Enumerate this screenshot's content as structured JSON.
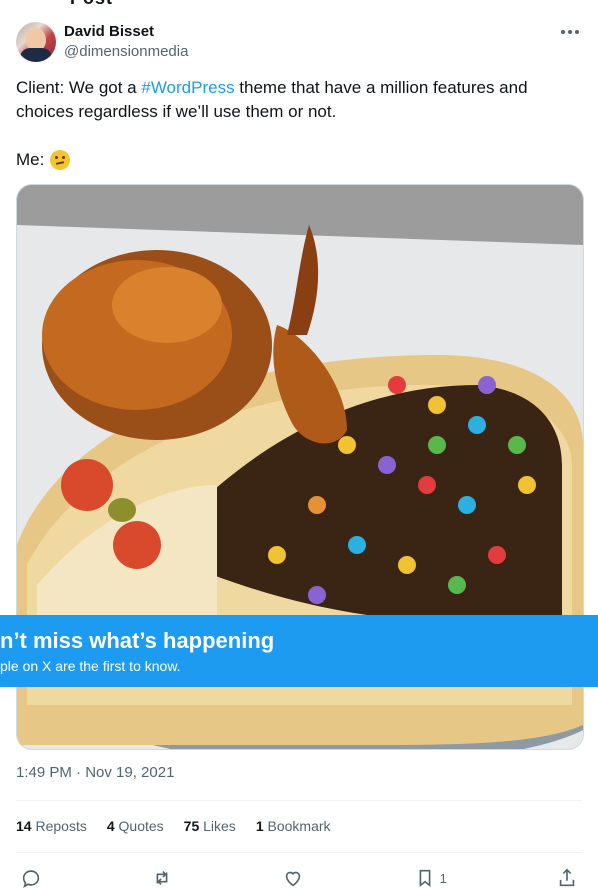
{
  "header": {
    "title_fragment": "Post"
  },
  "author": {
    "display_name": "David Bisset",
    "handle": "@dimensionmedia"
  },
  "tweet": {
    "text_before": "Client: We got a ",
    "hashtag": "#WordPress",
    "text_after": " theme that have a million features and choices regardless if we’ll use them or not.",
    "me_label": "Me:",
    "emoji_name": "thinking-face-emoji"
  },
  "banner": {
    "title": "n’t miss what’s happening",
    "subtitle": "ple on X are the first to know."
  },
  "timestamp": "1:49 PM · Nov 19, 2021",
  "stats": {
    "reposts_count": "14",
    "reposts_label": "Reposts",
    "quotes_count": "4",
    "quotes_label": "Quotes",
    "likes_count": "75",
    "likes_label": "Likes",
    "bookmarks_count": "1",
    "bookmarks_label": "Bookmark"
  },
  "actions": {
    "reply_icon": "reply-icon",
    "repost_icon": "repost-icon",
    "like_icon": "heart-icon",
    "bookmark_icon": "bookmark-icon",
    "bookmark_count": "1",
    "share_icon": "share-icon"
  },
  "colors": {
    "accent": "#1d9bf0",
    "text_primary": "#0f1419",
    "text_secondary": "#536471"
  }
}
